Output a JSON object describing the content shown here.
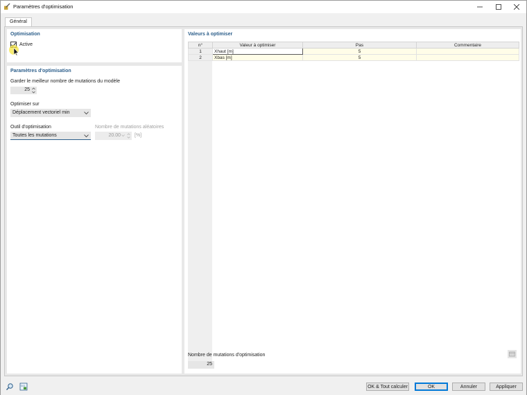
{
  "window": {
    "title": "Paramètres d'optimisation"
  },
  "tabs": [
    {
      "label": "Général"
    }
  ],
  "optimisation": {
    "title": "Optimisation",
    "active_label": "Active",
    "active_checked": true
  },
  "params": {
    "title": "Paramètres d'optimisation",
    "keep_best_label": "Garder le meilleur nombre de mutations du modèle",
    "keep_best_value": "25",
    "optimize_on_label": "Optimiser sur",
    "optimize_on_value": "Déplacement vectoriel min",
    "tool_label": "Outil d'optimisation",
    "tool_value": "Toutes les mutations",
    "random_label": "Nombre de mutations aléatoires",
    "random_value": "20.00",
    "random_unit": "[%]"
  },
  "values_panel": {
    "title": "Valeurs à optimiser",
    "columns": [
      "n°",
      "Valeur à optimiser",
      "Pas",
      "Commentaire"
    ],
    "rows": [
      {
        "n": "1",
        "value": "Xhaut [m]",
        "step": "5",
        "comment": ""
      },
      {
        "n": "2",
        "value": "Xbas [m]",
        "step": "5",
        "comment": ""
      }
    ],
    "mutations_label": "Nombre de mutations d'optimisation",
    "mutations_value": "25"
  },
  "buttons": {
    "ok_calc": "OK & Tout calculer",
    "ok": "OK",
    "cancel": "Annuler",
    "apply": "Appliquer"
  },
  "colors": {
    "accent": "#2d5f8b",
    "focus": "#0078d7",
    "cursor_highlight": "#f5e642"
  }
}
